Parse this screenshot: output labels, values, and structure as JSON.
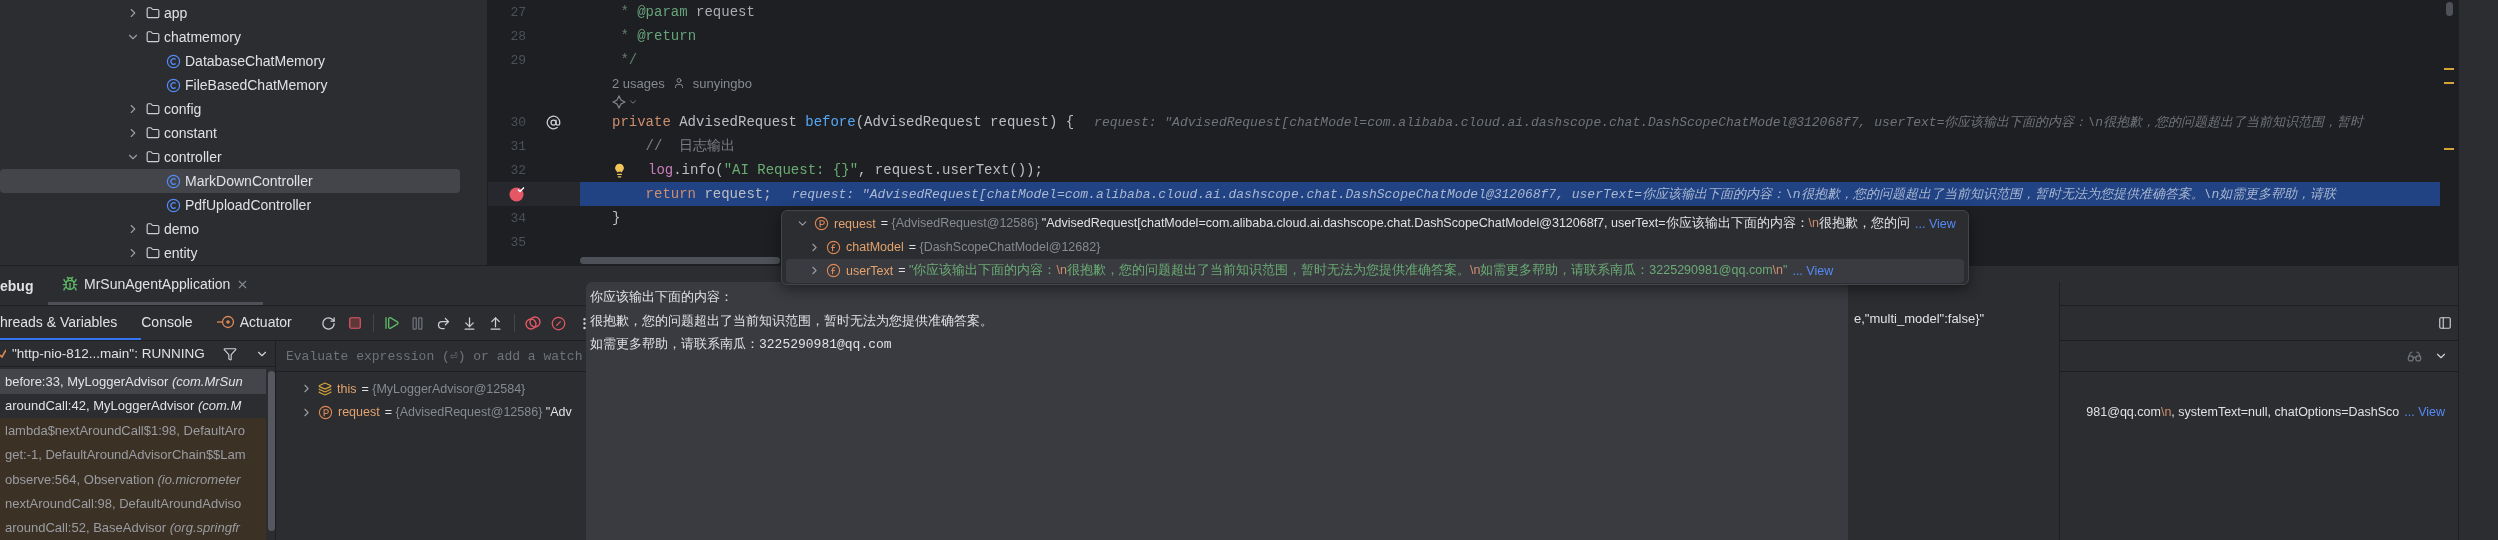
{
  "project_tree": [
    {
      "label": "app",
      "kind": "folder",
      "expanded": false,
      "selected": false
    },
    {
      "label": "chatmemory",
      "kind": "folder",
      "expanded": true,
      "selected": false,
      "children": [
        {
          "label": "DatabaseChatMemory",
          "kind": "class",
          "selected": false
        },
        {
          "label": "FileBasedChatMemory",
          "kind": "class",
          "selected": false
        }
      ]
    },
    {
      "label": "config",
      "kind": "folder",
      "expanded": false,
      "selected": false
    },
    {
      "label": "constant",
      "kind": "folder",
      "expanded": false,
      "selected": false
    },
    {
      "label": "controller",
      "kind": "folder",
      "expanded": true,
      "selected": false,
      "children": [
        {
          "label": "MarkDownController",
          "kind": "class",
          "selected": true
        },
        {
          "label": "PdfUploadController",
          "kind": "class",
          "selected": false
        }
      ]
    },
    {
      "label": "demo",
      "kind": "folder",
      "expanded": false,
      "selected": false
    },
    {
      "label": "entity",
      "kind": "folder",
      "expanded": false,
      "selected": false
    }
  ],
  "editor": {
    "lines": [
      {
        "kind": "code",
        "number": "27",
        "current": false,
        "breakpoint": false,
        "override": false,
        "intention": false,
        "segments": [
          {
            "text": " * ",
            "kind": "doc"
          },
          {
            "text": "@param",
            "kind": "doctag"
          },
          {
            "text": " request",
            "kind": "docparam"
          }
        ]
      },
      {
        "kind": "code",
        "number": "28",
        "current": false,
        "breakpoint": false,
        "override": false,
        "intention": false,
        "segments": [
          {
            "text": " * ",
            "kind": "doc"
          },
          {
            "text": "@return",
            "kind": "doctag"
          }
        ]
      },
      {
        "kind": "code",
        "number": "29",
        "current": false,
        "breakpoint": false,
        "override": false,
        "intention": false,
        "segments": [
          {
            "text": " */",
            "kind": "doc"
          }
        ]
      },
      {
        "kind": "usages",
        "usages": "2 usages",
        "author": "sunyingbo"
      },
      {
        "kind": "assistant"
      },
      {
        "kind": "code",
        "number": "30",
        "current": false,
        "breakpoint": false,
        "override": true,
        "intention": false,
        "segments": [
          {
            "text": "private",
            "kind": "keyword"
          },
          {
            "text": " AdvisedRequest ",
            "kind": "plain"
          },
          {
            "text": "before",
            "kind": "method"
          },
          {
            "text": "(AdvisedRequest request) {",
            "kind": "plain"
          }
        ],
        "hint": "request: \"AdvisedRequest[chatModel=com.alibaba.cloud.ai.dashscope.chat.DashScopeChatModel@312068f7, userText=你应该输出下面的内容：\\n很抱歉，您的问题超出了当前知识范围，暂时"
      },
      {
        "kind": "code",
        "number": "31",
        "current": false,
        "breakpoint": false,
        "override": false,
        "intention": false,
        "segments": [
          {
            "text": "    //  日志输出",
            "kind": "comment"
          }
        ]
      },
      {
        "kind": "code",
        "number": "32",
        "current": false,
        "breakpoint": false,
        "override": false,
        "intention": true,
        "segments": [
          {
            "text": "log",
            "kind": "field"
          },
          {
            "text": ".info(",
            "kind": "plain"
          },
          {
            "text": "\"AI Request: {}\"",
            "kind": "string"
          },
          {
            "text": ", request.userText());",
            "kind": "plain"
          }
        ]
      },
      {
        "kind": "code",
        "current": true,
        "breakpoint": true,
        "override": false,
        "intention": false,
        "segments": [
          {
            "text": "    return",
            "kind": "keyword"
          },
          {
            "text": " request;",
            "kind": "plain"
          }
        ],
        "hint": "request: \"AdvisedRequest[chatModel=com.alibaba.cloud.ai.dashscope.chat.DashScopeChatModel@312068f7, userText=你应该输出下面的内容：\\n很抱歉，您的问题超出了当前知识范围，暂时无法为您提供准确答案。\\n如需更多帮助，请联"
      },
      {
        "kind": "code",
        "number": "34",
        "current": false,
        "breakpoint": false,
        "override": false,
        "intention": false,
        "segments": [
          {
            "text": "}",
            "kind": "plain"
          }
        ]
      },
      {
        "kind": "code",
        "number": "35",
        "current": false,
        "breakpoint": false,
        "override": false,
        "intention": false
      }
    ]
  },
  "debug": {
    "title": "ebug",
    "run_tab": {
      "label": "MrSunAgentApplication",
      "selected": true
    },
    "tabs": [
      {
        "label": "hreads & Variables",
        "kind": "view",
        "selected": true
      },
      {
        "label": "Console",
        "kind": "view",
        "selected": false
      },
      {
        "label": "Actuator",
        "kind": "plugin",
        "selected": false
      }
    ],
    "thread": "\"http-nio-812...main\": RUNNING",
    "frames": [
      {
        "text": "before:33, MyLoggerAdvisor *(com.MrSun*",
        "selected": true,
        "library": false
      },
      {
        "text": "aroundCall:42, MyLoggerAdvisor *(com.M*",
        "selected": false,
        "library": false
      },
      {
        "text": "lambda$nextAroundCall$1:98, DefaultAro",
        "selected": false,
        "library": true
      },
      {
        "text": "get:-1, DefaultAroundAdvisorChain$$Lam",
        "selected": false,
        "library": true
      },
      {
        "text": "observe:564, Observation *(io.micrometer*",
        "selected": false,
        "library": true
      },
      {
        "text": "nextAroundCall:98, DefaultAroundAdviso",
        "selected": false,
        "library": true
      },
      {
        "text": "aroundCall:52, BaseAdvisor *(org.springfr*",
        "selected": false,
        "library": true
      }
    ],
    "evaluate": {
      "placeholder": "Evaluate expression (⏎) or add a watch"
    },
    "variables": [
      {
        "name": "this",
        "kind": "this",
        "expanded": false,
        "selected": false,
        "value": [
          {
            "text": "= ",
            "kind": "op"
          },
          {
            "text": "{MyLoggerAdvisor@12584}",
            "kind": "ref"
          }
        ]
      },
      {
        "name": "request",
        "kind": "param",
        "expanded": false,
        "selected": false,
        "value": [
          {
            "text": "= ",
            "kind": "op"
          },
          {
            "text": "{AdvisedRequest@12586}",
            "kind": "ref"
          },
          {
            "text": " \"Adv",
            "kind": "plain"
          }
        ],
        "tail": [
          {
            "text": "981@qq.com",
            "kind": "plain"
          },
          {
            "text": "\\n",
            "kind": "escape"
          },
          {
            "text": ", systemText=null, chatOptions=DashSco",
            "kind": "plain"
          }
        ],
        "link": "... View"
      }
    ]
  },
  "value_popup": {
    "variables": [
      {
        "name": "request",
        "kind": "param",
        "expanded": true,
        "selected": false,
        "value": [
          {
            "text": "= ",
            "kind": "op"
          },
          {
            "text": "{AdvisedRequest@12586}",
            "kind": "ref"
          },
          {
            "text": " \"AdvisedRequest[chatModel=com.alibaba.cloud.ai.dashscope.chat.DashScopeChatModel@312068f7, userText=你应该输出下面的内容：",
            "kind": "plain"
          },
          {
            "text": "\\n",
            "kind": "escape"
          },
          {
            "text": "很抱歉，您的问",
            "kind": "plain"
          }
        ],
        "link": "... View",
        "children": [
          {
            "name": "chatModel",
            "kind": "field",
            "expanded": false,
            "selected": false,
            "value": [
              {
                "text": "= ",
                "kind": "op"
              },
              {
                "text": "{DashScopeChatModel@12682}",
                "kind": "ref"
              }
            ]
          },
          {
            "name": "userText",
            "kind": "field",
            "expanded": false,
            "selected": true,
            "value": [
              {
                "text": "= ",
                "kind": "op"
              },
              {
                "text": "\"你应该输出下面的内容：",
                "kind": "string"
              },
              {
                "text": "\\n",
                "kind": "escape"
              },
              {
                "text": "很抱歉，您的问题超出了当前知识范围，暂时无法为您提供准确答案。",
                "kind": "string"
              },
              {
                "text": "\\n",
                "kind": "escape"
              },
              {
                "text": "如需更多帮助，请联系南瓜：3225290981@qq.com",
                "kind": "string"
              },
              {
                "text": "\\n",
                "kind": "escape"
              },
              {
                "text": "\"",
                "kind": "string"
              }
            ],
            "link": "... View"
          }
        ]
      }
    ]
  },
  "text_popup": {
    "lines": [
      "你应该输出下面的内容：",
      "很抱歉，您的问题超出了当前知识范围，暂时无法为您提供准确答案。",
      "如需更多帮助，请联系南瓜：3225290981@qq.com"
    ]
  },
  "string_popup": {
    "text": "e,\"multi_model\":false}\""
  }
}
